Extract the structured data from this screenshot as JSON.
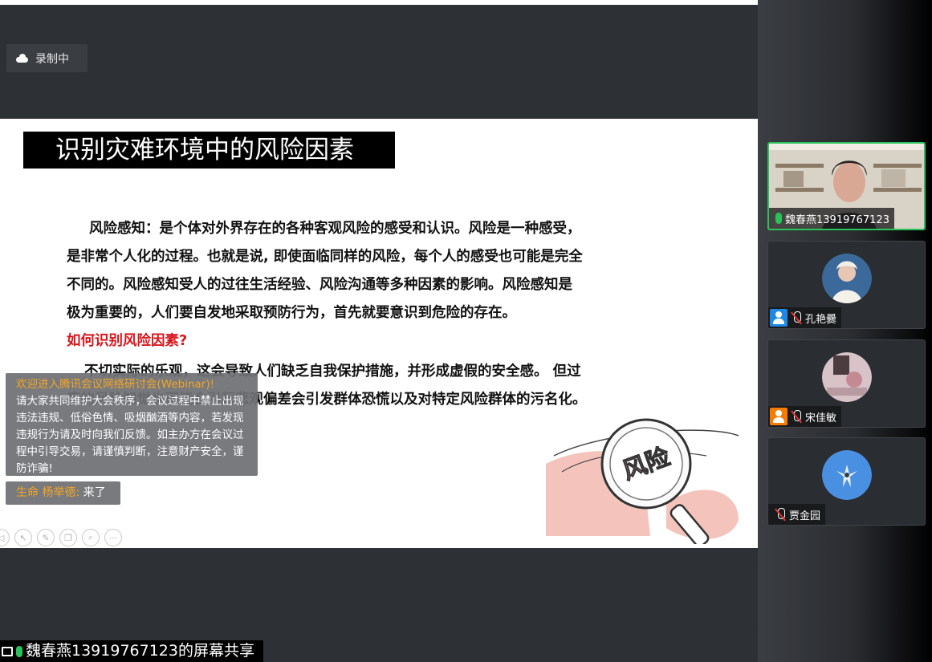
{
  "recording": {
    "label": "录制中"
  },
  "slide": {
    "title": "识别灾难环境中的风险因素",
    "para1": [
      "风险感知：是个体对外界存在的各种客观风险的感受和认识。风险是一种感受，",
      "是非常个人化的过程。也就是说, 即使面临同样的风险，每个人的感受也可能是完全",
      "不同的。风险感知受人的过往生活经验、风险沟通等多种因素的影响。风险感知是",
      "极为重要的，人们要自发地采取预防行为，首先就要意识到危险的存在。"
    ],
    "heading": "如何识别风险因素?",
    "para2": [
      "不切实际的乐观，这会导致人们缺乏自我保护措施，并形成虚假的安全感。 但过",
      "度的风险知觉也可能会引起悲观偏差会引发群体恐慌以及对特定风险群体的污名化。"
    ],
    "illustration_text": "风险"
  },
  "notice": {
    "title": "欢迎进入腾讯会议网络研讨会(Webinar)!",
    "body": "请大家共同维护大会秩序，会议过程中禁止出现违法违规、低俗色情、吸烟酗酒等内容，若发现违规行为请及时向我们反馈。如主办方在会议过程中引导交易，请谨慎判断，注意财产安全，谨防诈骗!"
  },
  "join_message": {
    "name": "生命 杨举德:",
    "text": " 来了"
  },
  "share_bar": {
    "label": "魏春燕13919767123的屏幕共享"
  },
  "participants": [
    {
      "name": "魏春燕13919767123"
    },
    {
      "name": "孔艳爨"
    },
    {
      "name": "宋佳敏"
    },
    {
      "name": "贾金园"
    }
  ],
  "colors": {
    "accent_green": "#28c45a",
    "heading_red": "#d9161c",
    "notice_orange": "#f5a623"
  }
}
